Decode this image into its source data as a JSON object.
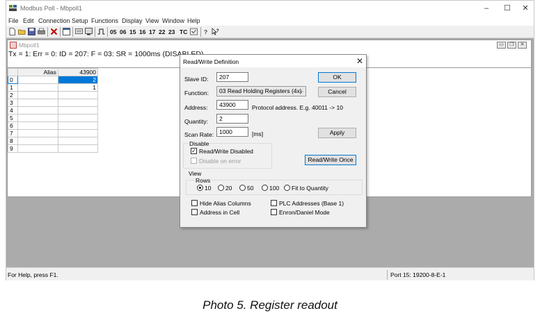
{
  "window": {
    "title": "Modbus Poll - Mbpoll1",
    "controls": [
      "–",
      "☐",
      "✕"
    ]
  },
  "menu": [
    "File",
    "Edit",
    "Connection",
    "Setup",
    "Functions",
    "Display",
    "View",
    "Window",
    "Help"
  ],
  "toolbar": {
    "codes": [
      "05",
      "06",
      "15",
      "16",
      "17",
      "22",
      "23",
      "TC"
    ],
    "help_label": "?"
  },
  "child_window": {
    "title": "Mbpoll1",
    "status": "Tx = 1: Err = 0: ID = 207: F = 03: SR = 1000ms  (DISABLED)"
  },
  "grid": {
    "headers": [
      "Alias",
      "43900"
    ],
    "rows": [
      {
        "index": "0",
        "alias": "",
        "value": "2"
      },
      {
        "index": "1",
        "alias": "",
        "value": "1"
      },
      {
        "index": "2",
        "alias": "",
        "value": ""
      },
      {
        "index": "3",
        "alias": "",
        "value": ""
      },
      {
        "index": "4",
        "alias": "",
        "value": ""
      },
      {
        "index": "5",
        "alias": "",
        "value": ""
      },
      {
        "index": "6",
        "alias": "",
        "value": ""
      },
      {
        "index": "7",
        "alias": "",
        "value": ""
      },
      {
        "index": "8",
        "alias": "",
        "value": ""
      },
      {
        "index": "9",
        "alias": "",
        "value": ""
      }
    ]
  },
  "dialog": {
    "title": "Read/Write Definition",
    "slave_id_label": "Slave ID:",
    "slave_id": "207",
    "function_label": "Function:",
    "function_value": "03 Read Holding Registers (4x)",
    "address_label": "Address:",
    "address": "43900",
    "address_hint": "Protocol address. E.g. 40011 -> 10",
    "quantity_label": "Quantity:",
    "quantity": "2",
    "scan_rate_label": "Scan Rate:",
    "scan_rate": "1000",
    "scan_rate_unit": "[ms]",
    "ok_label": "OK",
    "cancel_label": "Cancel",
    "apply_label": "Apply",
    "read_write_once_label": "Read/Write Once",
    "disable_group": "Disable",
    "rw_disabled_label": "Read/Write Disabled",
    "rw_disabled_checked": true,
    "disable_on_error_label": "Disable on error",
    "view_group": "View",
    "rows_group": "Rows",
    "rows_options": [
      "10",
      "20",
      "50",
      "100",
      "Fit to Quantity"
    ],
    "rows_selected": "10",
    "hide_alias_label": "Hide Alias Columns",
    "address_in_cell_label": "Address in Cell",
    "plc_addresses_label": "PLC Addresses (Base 1)",
    "enron_label": "Enron/Daniel Mode"
  },
  "statusbar": {
    "help": "For Help, press F1.",
    "port": "Port 15: 19200-8-E-1"
  },
  "caption": "Photo 5. Register readout",
  "colors": {
    "selection": "#0078d7",
    "mdi_background": "#ababab"
  }
}
